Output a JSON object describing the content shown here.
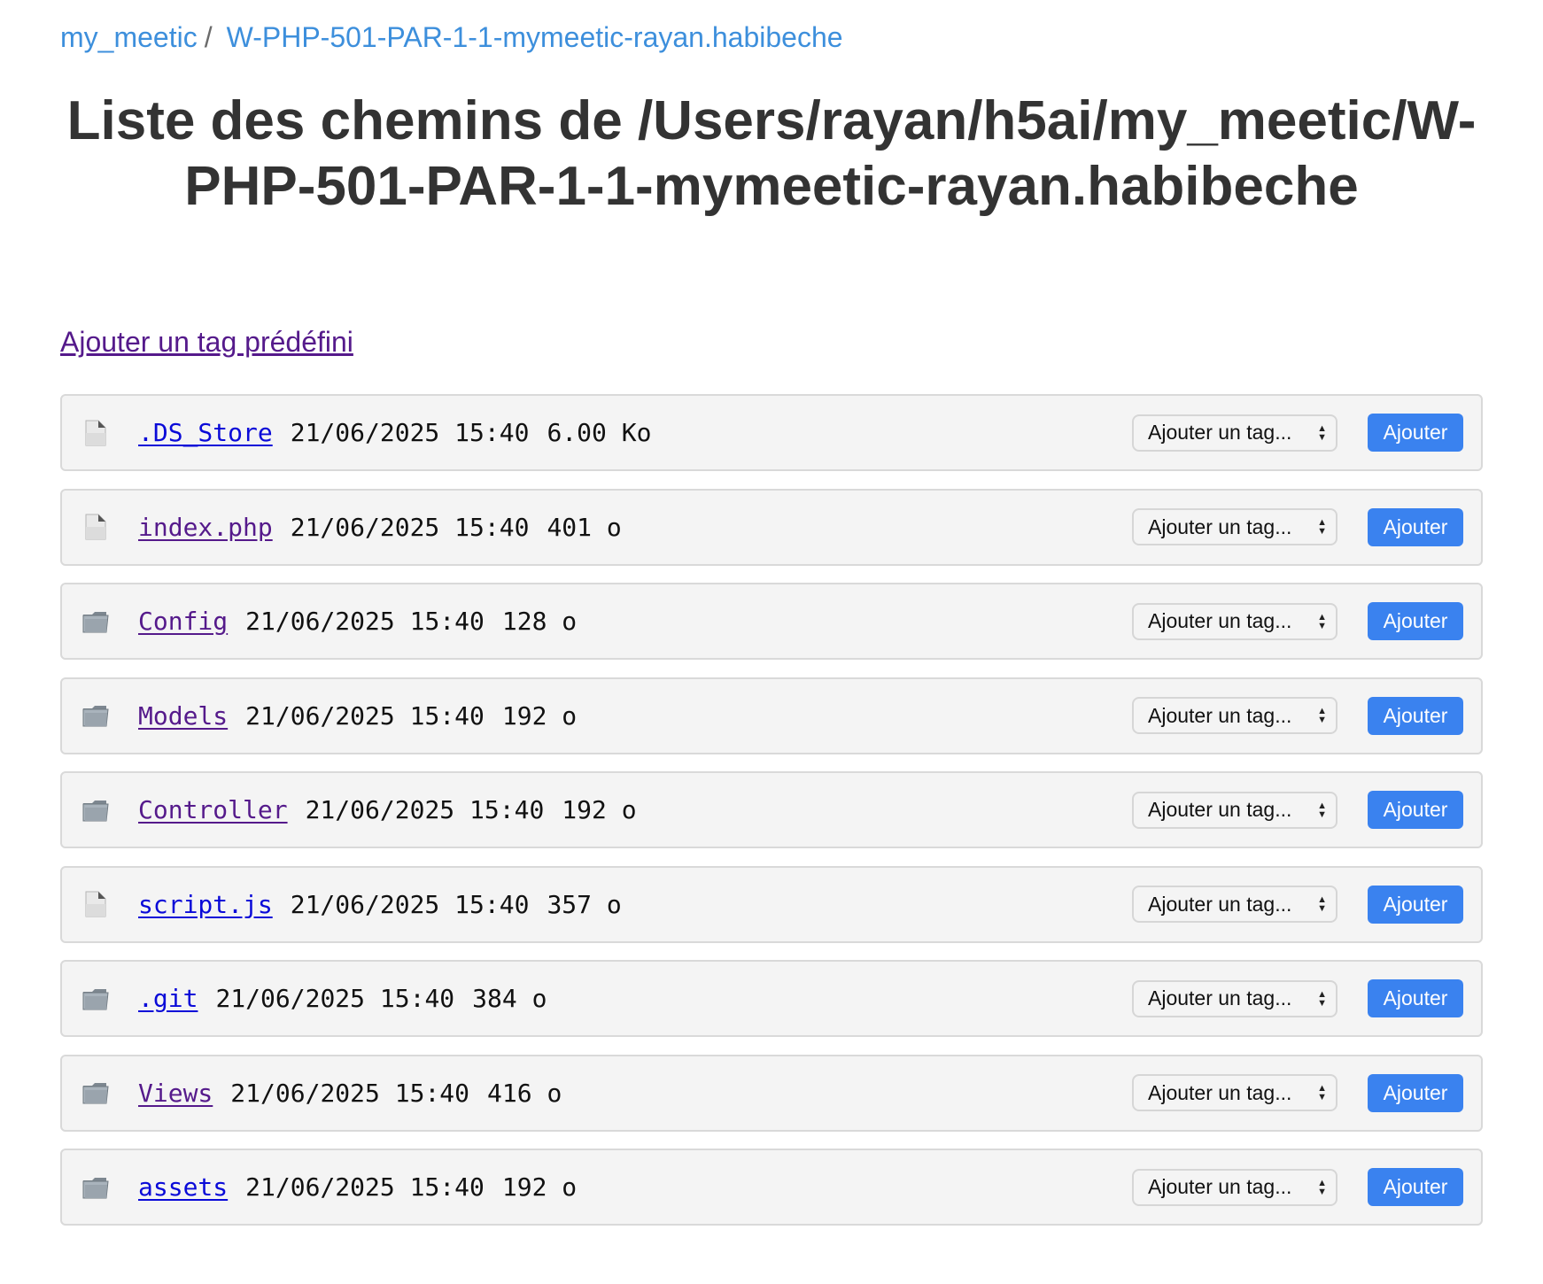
{
  "breadcrumb": {
    "items": [
      {
        "label": "my_meetic"
      },
      {
        "label": "W-PHP-501-PAR-1-1-mymeetic-rayan.habibeche"
      }
    ],
    "separator": "/"
  },
  "title": "Liste des chemins de /Users/rayan/h5ai/my_meetic/W-PHP-501-PAR-1-1-mymeetic-rayan.habibeche",
  "add_predefined_tag_label": "Ajouter un tag prédéfini",
  "entries": [
    {
      "name": ".DS_Store",
      "date": "21/06/2025 15:40",
      "size": "6.00 Ko",
      "icon": "file-icon",
      "visited": false,
      "select_value": "Ajouter un tag...",
      "button_label": "Ajouter"
    },
    {
      "name": "index.php",
      "date": "21/06/2025 15:40",
      "size": "401 o",
      "icon": "file-icon",
      "visited": true,
      "select_value": "Ajouter un tag...",
      "button_label": "Ajouter"
    },
    {
      "name": "Config",
      "date": "21/06/2025 15:40",
      "size": "128 o",
      "icon": "folder-icon",
      "visited": true,
      "select_value": "Ajouter un tag...",
      "button_label": "Ajouter"
    },
    {
      "name": "Models",
      "date": "21/06/2025 15:40",
      "size": "192 o",
      "icon": "folder-icon",
      "visited": true,
      "select_value": "Ajouter un tag...",
      "button_label": "Ajouter"
    },
    {
      "name": "Controller",
      "date": "21/06/2025 15:40",
      "size": "192 o",
      "icon": "folder-icon",
      "visited": true,
      "select_value": "Ajouter un tag...",
      "button_label": "Ajouter"
    },
    {
      "name": "script.js",
      "date": "21/06/2025 15:40",
      "size": "357 o",
      "icon": "file-icon",
      "visited": false,
      "select_value": "Ajouter un tag...",
      "button_label": "Ajouter"
    },
    {
      "name": ".git",
      "date": "21/06/2025 15:40",
      "size": "384 o",
      "icon": "folder-icon",
      "visited": false,
      "select_value": "Ajouter un tag...",
      "button_label": "Ajouter"
    },
    {
      "name": "Views",
      "date": "21/06/2025 15:40",
      "size": "416 o",
      "icon": "folder-icon",
      "visited": true,
      "select_value": "Ajouter un tag...",
      "button_label": "Ajouter"
    },
    {
      "name": "assets",
      "date": "21/06/2025 15:40",
      "size": "192 o",
      "icon": "folder-icon",
      "visited": false,
      "select_value": "Ajouter un tag...",
      "button_label": "Ajouter"
    }
  ],
  "colors": {
    "breadcrumb_link": "#3d8fdc",
    "link_unvisited": "#0a0ad8",
    "link_visited": "#551a8b",
    "button_bg": "#3a82ef",
    "row_bg": "#f4f4f4"
  }
}
